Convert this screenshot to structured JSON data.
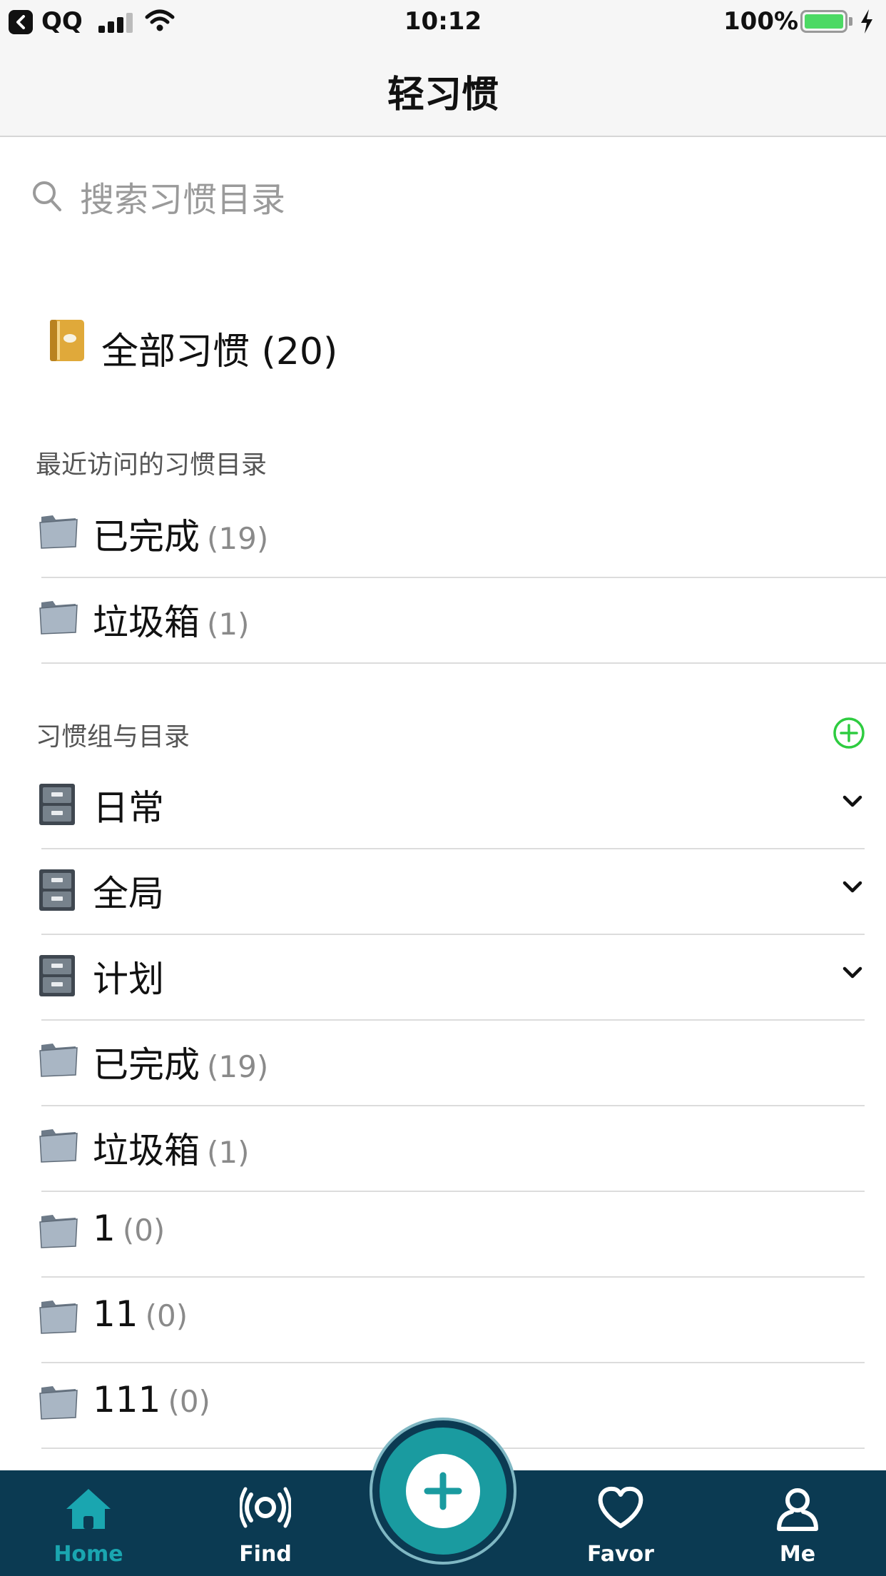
{
  "status_bar": {
    "back_app": "QQ",
    "time": "10:12",
    "battery": "100%",
    "battery_level": 1.0
  },
  "nav": {
    "title": "轻习惯"
  },
  "search": {
    "placeholder": "搜索习惯目录"
  },
  "all_habits": {
    "label": "全部习惯 (20)",
    "icon": "notebook-icon"
  },
  "recent": {
    "header": "最近访问的习惯目录",
    "items": [
      {
        "name": "已完成",
        "count": "(19)",
        "icon": "folder-icon"
      },
      {
        "name": "垃圾箱",
        "count": "(1)",
        "icon": "folder-icon"
      }
    ]
  },
  "groups": {
    "header": "习惯组与目录",
    "add_icon": "add-circle-icon",
    "accent": "#2ecc40",
    "items": [
      {
        "name": "日常",
        "icon": "file-cabinet-icon",
        "expandable": true
      },
      {
        "name": "全局",
        "icon": "file-cabinet-icon",
        "expandable": true
      },
      {
        "name": "计划",
        "icon": "file-cabinet-icon",
        "expandable": true
      },
      {
        "name": "已完成",
        "count": "(19)",
        "icon": "folder-icon"
      },
      {
        "name": "垃圾箱",
        "count": "(1)",
        "icon": "folder-icon"
      },
      {
        "name": "1",
        "count": "(0)",
        "icon": "folder-icon"
      },
      {
        "name": "11",
        "count": "(0)",
        "icon": "folder-icon"
      },
      {
        "name": "111",
        "count": "(0)",
        "icon": "folder-icon"
      }
    ]
  },
  "tabbar": {
    "background": "#0b3a52",
    "active_color": "#1aa6b0",
    "tabs": [
      {
        "label": "Home",
        "icon": "home-icon",
        "active": true
      },
      {
        "label": "Find",
        "icon": "broadcast-icon",
        "active": false
      },
      {
        "label": "",
        "icon": "plus-icon",
        "active": false
      },
      {
        "label": "Favor",
        "icon": "heart-icon",
        "active": false
      },
      {
        "label": "Me",
        "icon": "user-icon",
        "active": false
      }
    ]
  }
}
